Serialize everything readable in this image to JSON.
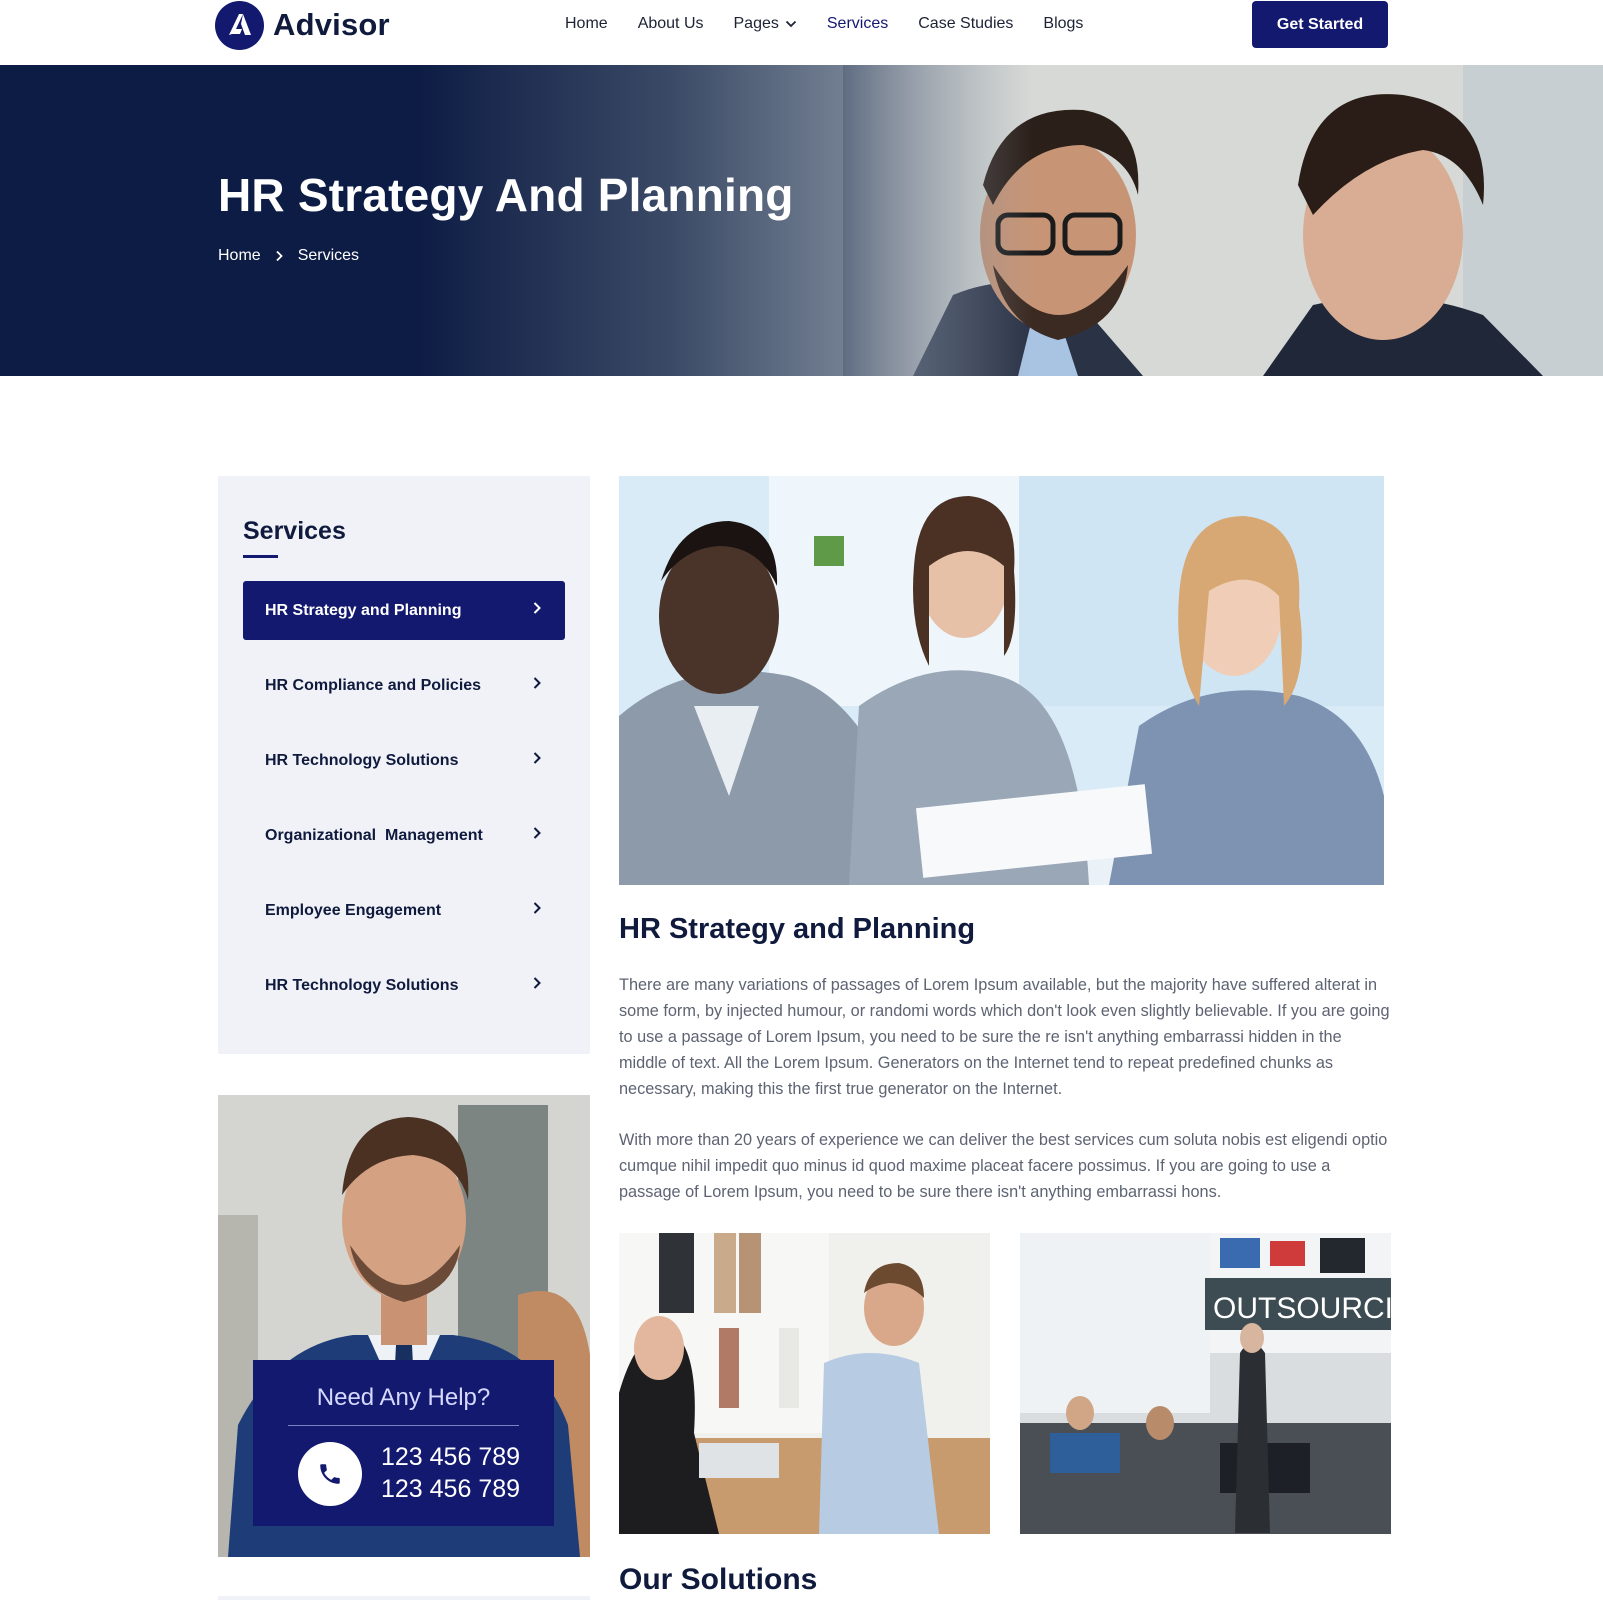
{
  "brand": {
    "name": "Advisor",
    "primary": "#13196e",
    "dark": "#0f1a3d"
  },
  "nav": {
    "items": [
      {
        "label": "Home"
      },
      {
        "label": "About Us"
      },
      {
        "label": "Pages"
      },
      {
        "label": "Services",
        "active": true
      },
      {
        "label": "Case Studies"
      },
      {
        "label": "Blogs"
      }
    ],
    "cta": "Get Started"
  },
  "hero": {
    "title": "HR Strategy And Planning",
    "breadcrumb": {
      "home": "Home",
      "current": "Services"
    }
  },
  "sidebar": {
    "title": "Services",
    "items": [
      {
        "label": "HR Strategy and Planning",
        "active": true
      },
      {
        "label": "HR Compliance and Policies"
      },
      {
        "label": "HR Technology Solutions"
      },
      {
        "label": "Organizational  Management"
      },
      {
        "label": "Employee Engagement"
      },
      {
        "label": "HR Technology Solutions"
      }
    ],
    "help": {
      "title": "Need Any Help?",
      "phone1": "123 456 789",
      "phone2": "123 456 789"
    }
  },
  "main": {
    "title": "HR Strategy and Planning",
    "paragraphs": [
      "There are many variations of passages of Lorem Ipsum available, but the majority have suffered alterat in some form, by injected humour, or randomi words which don't look even slightly believable. If you are going to use a passage of Lorem Ipsum, you need to be sure the re isn't anything embarrassi hidden in the middle of text. All the Lorem Ipsum. Generators on the Internet tend to repeat predefined chunks as necessary, making this the first true generator on the Internet.",
      "With more than 20 years of experience we can deliver the best services cum soluta nobis est eligendi optio cumque nihil impedit quo minus id quod maxime placeat facere possimus. If you are going to use a passage of Lorem Ipsum, you need to be sure there isn't anything embarrassi hons."
    ],
    "outsourcing_sign": "OUTSOURCING",
    "section_title": "Our Solutions"
  },
  "icons": {
    "logo": "advisor-logo-icon",
    "chevron": "chevron-right-icon",
    "phone": "phone-icon"
  }
}
